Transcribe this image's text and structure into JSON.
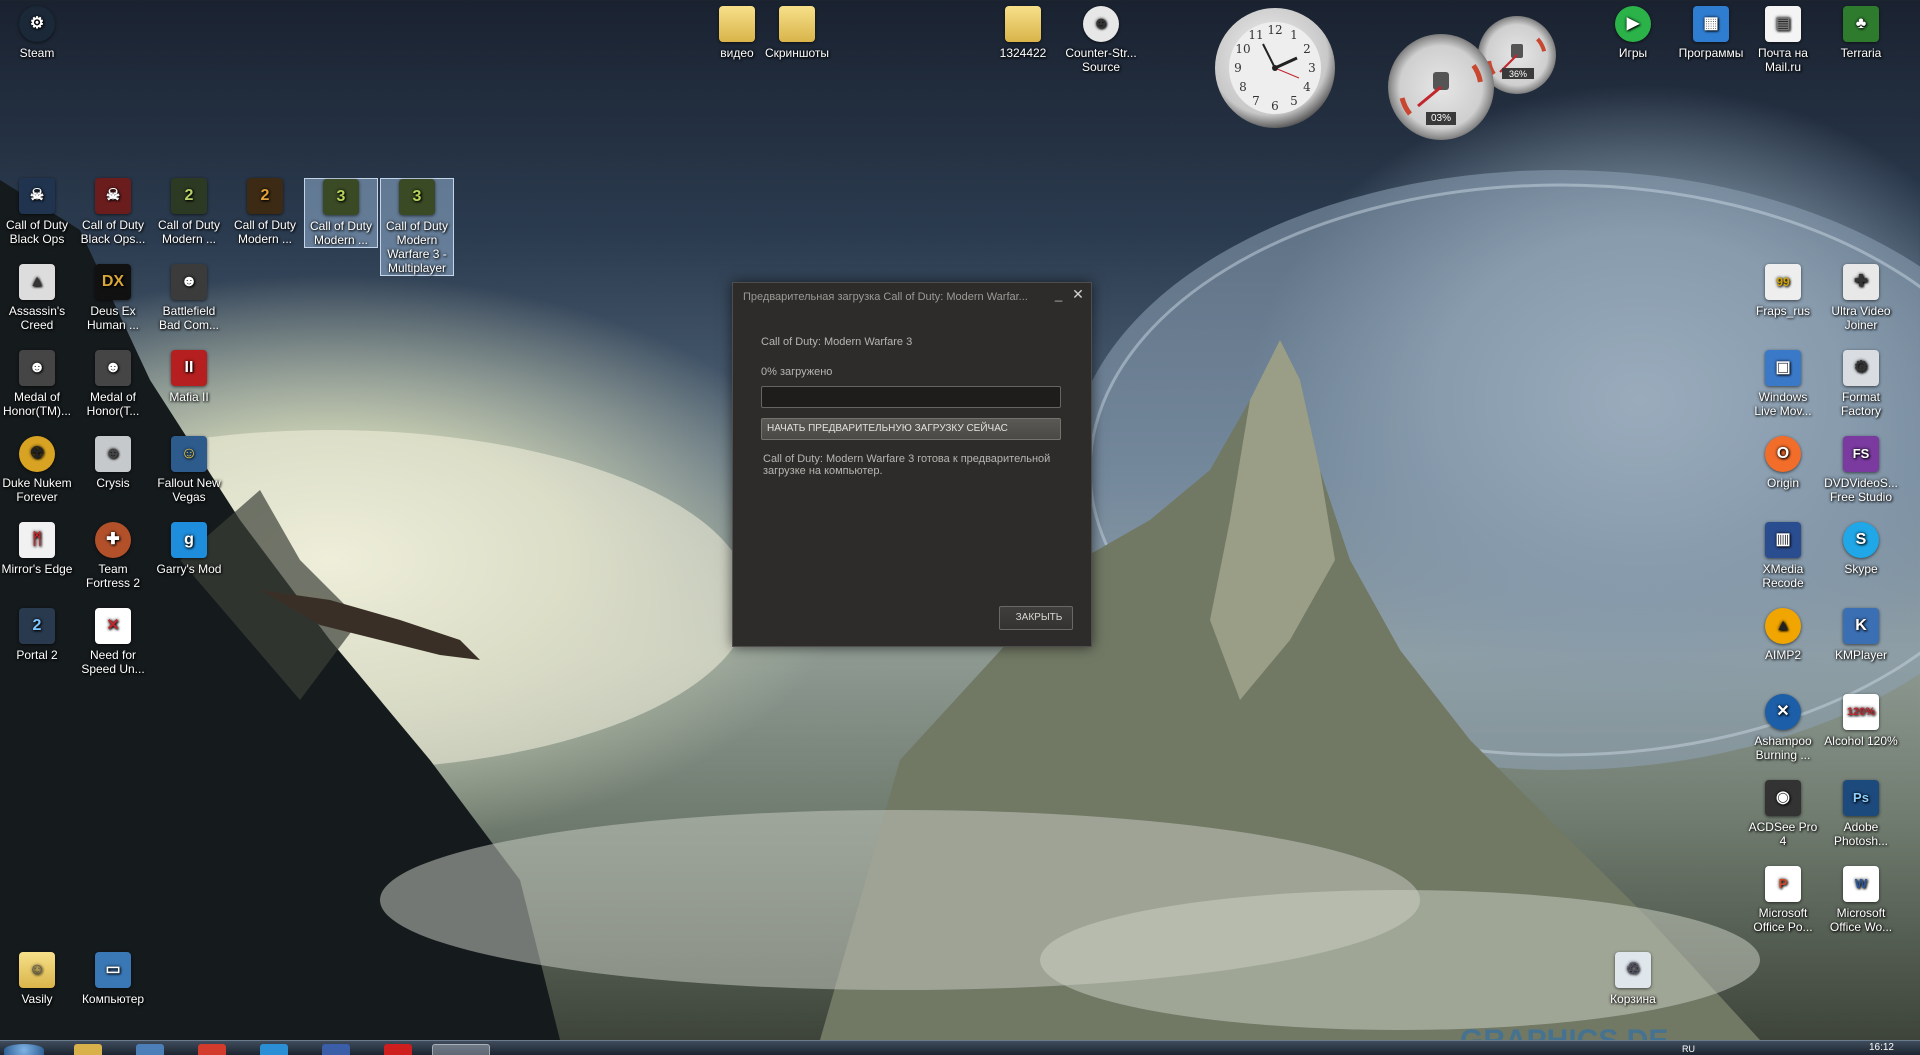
{
  "desktop": {
    "icons_top_left": [
      {
        "label": "Steam",
        "icon": "steam-icon"
      }
    ],
    "icons_top_center": [
      {
        "label": "видео",
        "icon": "folder-icon"
      },
      {
        "label": "Скриншоты",
        "icon": "folder-icon"
      },
      {
        "label": "1324422",
        "icon": "folder-icon"
      },
      {
        "label": "Counter-Str... Source",
        "icon": "counter-strike-icon"
      }
    ],
    "icons_top_right": [
      {
        "label": "Игры",
        "icon": "play-icon"
      },
      {
        "label": "Программы",
        "icon": "programs-icon"
      },
      {
        "label": "Почта на Mail.ru",
        "icon": "document-icon"
      },
      {
        "label": "Terraria",
        "icon": "tree-icon"
      }
    ],
    "icons_left": [
      {
        "label": "Call of Duty Black Ops",
        "icon": "black-ops-icon"
      },
      {
        "label": "Call of Duty Black Ops...",
        "icon": "black-ops-icon"
      },
      {
        "label": "Call of Duty Modern ...",
        "icon": "mw2-icon"
      },
      {
        "label": "Call of Duty Modern ...",
        "icon": "mw2-icon"
      },
      {
        "label": "Call of Duty Modern ...",
        "icon": "mw3-icon"
      },
      {
        "label": "Call of Duty Modern Warfare 3 - Multiplayer",
        "icon": "mw3-icon"
      },
      {
        "label": "Assassin's Creed",
        "icon": "assassins-creed-icon"
      },
      {
        "label": "Deus Ex Human ...",
        "icon": "deus-ex-icon"
      },
      {
        "label": "Battlefield Bad Com...",
        "icon": "battlefield-icon"
      },
      {
        "label": "Medal of Honor(TM)...",
        "icon": "medal-of-honor-icon"
      },
      {
        "label": "Medal of Honor(T...",
        "icon": "medal-of-honor-icon"
      },
      {
        "label": "Mafia II",
        "icon": "mafia-icon"
      },
      {
        "label": "Duke Nukem Forever",
        "icon": "radiation-icon"
      },
      {
        "label": "Crysis",
        "icon": "crysis-icon"
      },
      {
        "label": "Fallout New Vegas",
        "icon": "fallout-icon"
      },
      {
        "label": "Mirror's Edge",
        "icon": "mirrors-edge-icon"
      },
      {
        "label": "Team Fortress 2",
        "icon": "tf2-icon"
      },
      {
        "label": "Garry's Mod",
        "icon": "garrys-mod-icon"
      },
      {
        "label": "Portal 2",
        "icon": "portal-icon"
      },
      {
        "label": "Need for Speed Un...",
        "icon": "nfs-icon"
      },
      {
        "label": "Vasily",
        "icon": "user-folder-icon"
      },
      {
        "label": "Компьютер",
        "icon": "computer-icon"
      }
    ],
    "icons_right": [
      {
        "label": "Fraps_rus",
        "icon": "fraps-icon"
      },
      {
        "label": "Ultra Video Joiner",
        "icon": "video-joiner-icon"
      },
      {
        "label": "Windows Live Mov...",
        "icon": "movie-maker-icon"
      },
      {
        "label": "Format Factory",
        "icon": "format-factory-icon"
      },
      {
        "label": "Origin",
        "icon": "origin-icon"
      },
      {
        "label": "DVDVideoS... Free Studio",
        "icon": "fs-icon"
      },
      {
        "label": "XMedia Recode",
        "icon": "film-icon"
      },
      {
        "label": "Skype",
        "icon": "skype-icon"
      },
      {
        "label": "AIMP2",
        "icon": "aimp-icon"
      },
      {
        "label": "KMPlayer",
        "icon": "kmplayer-icon"
      },
      {
        "label": "Ashampoo Burning ...",
        "icon": "ashampoo-icon"
      },
      {
        "label": "Alcohol 120%",
        "icon": "alcohol-icon"
      },
      {
        "label": "ACDSee Pro 4",
        "icon": "camera-icon"
      },
      {
        "label": "Adobe Photosh...",
        "icon": "photoshop-icon"
      },
      {
        "label": "Microsoft Office Po...",
        "icon": "powerpoint-icon"
      },
      {
        "label": "Microsoft Office Wo...",
        "icon": "word-icon"
      },
      {
        "label": "Корзина",
        "icon": "recycle-bin-icon"
      }
    ]
  },
  "gadgets": {
    "clock_numbers": [
      "12",
      "1",
      "2",
      "3",
      "4",
      "5",
      "6",
      "7",
      "8",
      "9",
      "10",
      "11"
    ],
    "cpu_percent": "03%",
    "memory_percent": "36%"
  },
  "dialog": {
    "title": "Предварительная загрузка Call of Duty: Modern Warfar...",
    "game_name": "Call of Duty: Modern Warfare 3",
    "progress_text": "0% загружено",
    "progress": 0,
    "start_button": "НАЧАТЬ ПРЕДВАРИТЕЛЬНУЮ ЗАГРУЗКУ СЕЙЧАС",
    "message": "Call of Duty: Modern Warfare 3 готова к предварительной загрузке на компьютер.",
    "close_button": "ЗАКРЫТЬ"
  },
  "wallpaper": {
    "watermark": "GRAPHICS.DE"
  },
  "taskbar": {
    "time": "16:12",
    "lang": "RU"
  }
}
